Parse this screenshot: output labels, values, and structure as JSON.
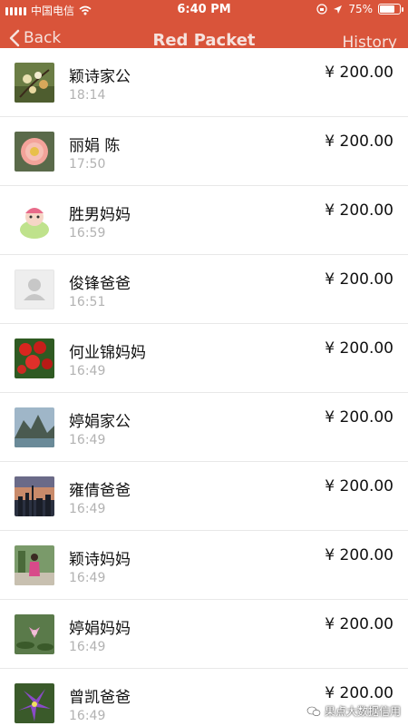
{
  "status_bar": {
    "carrier": "中国电信",
    "time": "6:40 PM",
    "battery": "75%",
    "battery_level": 0.75,
    "icons": [
      "signal-icon",
      "wifi-icon",
      "orientation-lock-icon",
      "location-icon",
      "battery-icon"
    ]
  },
  "nav": {
    "back_label": "Back",
    "title": "Red Packet",
    "history_label": "History"
  },
  "colors": {
    "header": "#d9543a",
    "divider": "#e8e8e8",
    "time_text": "#b2b2b2"
  },
  "records": [
    {
      "name": "颖诗家公",
      "time": "18:14",
      "amount": "¥ 200.00",
      "avatar": "flower-branch-avatar"
    },
    {
      "name": "丽娟 陈",
      "time": "17:50",
      "amount": "¥ 200.00",
      "avatar": "pink-flower-avatar"
    },
    {
      "name": "胜男妈妈",
      "time": "16:59",
      "amount": "¥ 200.00",
      "avatar": "cartoon-avatar"
    },
    {
      "name": "俊锋爸爸",
      "time": "16:51",
      "amount": "¥ 200.00",
      "avatar": "default-user-avatar"
    },
    {
      "name": "何业锦妈妈",
      "time": "16:49",
      "amount": "¥ 200.00",
      "avatar": "red-flowers-avatar"
    },
    {
      "name": "婷娟家公",
      "time": "16:49",
      "amount": "¥ 200.00",
      "avatar": "landscape-avatar"
    },
    {
      "name": "雍倩爸爸",
      "time": "16:49",
      "amount": "¥ 200.00",
      "avatar": "sunset-city-avatar"
    },
    {
      "name": "颖诗妈妈",
      "time": "16:49",
      "amount": "¥ 200.00",
      "avatar": "person-photo-avatar"
    },
    {
      "name": "婷娟妈妈",
      "time": "16:49",
      "amount": "¥ 200.00",
      "avatar": "lotus-avatar"
    },
    {
      "name": "曾凯爸爸",
      "time": "16:49",
      "amount": "¥ 200.00",
      "avatar": "purple-flowers-avatar"
    }
  ],
  "watermark": "果点大数据信用"
}
